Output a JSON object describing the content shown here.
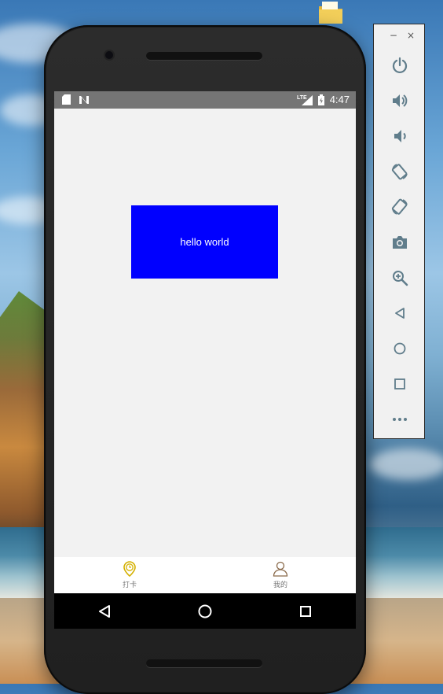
{
  "status_bar": {
    "time": "4:47",
    "network": "LTE"
  },
  "content": {
    "box_text": "hello world",
    "box_color": "#0000ff"
  },
  "tabbar": {
    "tabs": [
      {
        "label": "打卡",
        "icon": "clock-pin-icon",
        "active": true,
        "color": "#e6c200"
      },
      {
        "label": "我的",
        "icon": "person-icon",
        "active": false,
        "color": "#8a6a4a"
      }
    ]
  },
  "android_nav": {
    "buttons": [
      "back-icon",
      "home-icon",
      "recents-icon"
    ]
  },
  "emulator_panel": {
    "window_controls": {
      "minimize": "−",
      "close": "×"
    },
    "buttons": [
      "power-icon",
      "volume-up-icon",
      "volume-down-icon",
      "rotate-left-icon",
      "rotate-right-icon",
      "camera-icon",
      "zoom-icon",
      "back-icon",
      "home-icon",
      "overview-icon",
      "more-icon"
    ],
    "icon_color": "#607d8b"
  }
}
